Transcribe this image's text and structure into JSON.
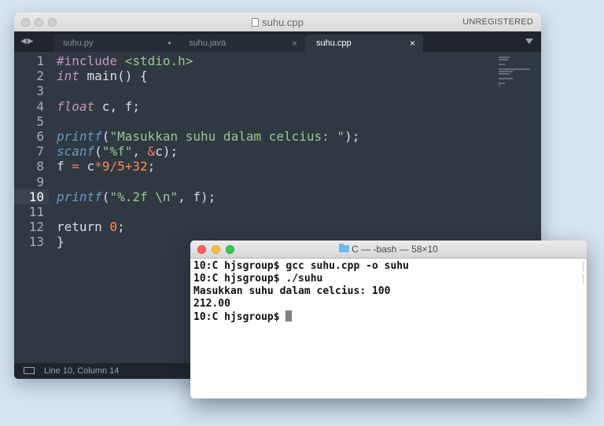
{
  "editor": {
    "window_title": "suhu.cpp",
    "registration": "UNREGISTERED",
    "nav_arrows": "◀▶",
    "tabs": [
      {
        "label": "suhu.py",
        "close": "●"
      },
      {
        "label": "suhu.java",
        "close": "×"
      },
      {
        "label": "suhu.cpp",
        "close": "×"
      }
    ],
    "active_tab": "suhu.cpp",
    "line_numbers": [
      "1",
      "2",
      "3",
      "4",
      "5",
      "6",
      "7",
      "8",
      "9",
      "10",
      "11",
      "12",
      "13"
    ],
    "current_line": "10",
    "code": [
      [
        {
          "t": "#include ",
          "c": "inc"
        },
        {
          "t": "<stdio.h>",
          "c": "str"
        }
      ],
      [
        {
          "t": "int",
          "c": "kw-italic"
        },
        {
          "t": " main() {",
          "c": "plain"
        }
      ],
      [],
      [
        {
          "t": "float",
          "c": "kw-italic"
        },
        {
          "t": " c, f;",
          "c": "plain"
        }
      ],
      [],
      [
        {
          "t": "printf",
          "c": "fn"
        },
        {
          "t": "(",
          "c": "plain"
        },
        {
          "t": "\"Masukkan suhu dalam celcius: \"",
          "c": "str"
        },
        {
          "t": ");",
          "c": "plain"
        }
      ],
      [
        {
          "t": "scanf",
          "c": "fn"
        },
        {
          "t": "(",
          "c": "plain"
        },
        {
          "t": "\"%f\"",
          "c": "str"
        },
        {
          "t": ", ",
          "c": "plain"
        },
        {
          "t": "&",
          "c": "op"
        },
        {
          "t": "c);",
          "c": "plain"
        }
      ],
      [
        {
          "t": "f ",
          "c": "plain"
        },
        {
          "t": "=",
          "c": "op"
        },
        {
          "t": " c",
          "c": "plain"
        },
        {
          "t": "*",
          "c": "op"
        },
        {
          "t": "9",
          "c": "num"
        },
        {
          "t": "/",
          "c": "op"
        },
        {
          "t": "5",
          "c": "num"
        },
        {
          "t": "+",
          "c": "op"
        },
        {
          "t": "32",
          "c": "num"
        },
        {
          "t": ";",
          "c": "plain"
        }
      ],
      [],
      [
        {
          "t": "printf",
          "c": "fn"
        },
        {
          "t": "(",
          "c": "plain"
        },
        {
          "t": "\"%.2f \\n\"",
          "c": "str"
        },
        {
          "t": ", f);",
          "c": "plain"
        }
      ],
      [],
      [
        {
          "t": "return ",
          "c": "plain"
        },
        {
          "t": "0",
          "c": "num"
        },
        {
          "t": ";",
          "c": "plain"
        }
      ],
      [
        {
          "t": "}",
          "c": "plain"
        }
      ]
    ],
    "status": "Line 10, Column 14"
  },
  "terminal": {
    "title": "C — -bash — 58×10",
    "lines": [
      "10:C hjsgroup$ gcc suhu.cpp -o suhu",
      "10:C hjsgroup$ ./suhu",
      "Masukkan suhu dalam celcius: 100",
      "212.00",
      "10:C hjsgroup$ "
    ]
  }
}
